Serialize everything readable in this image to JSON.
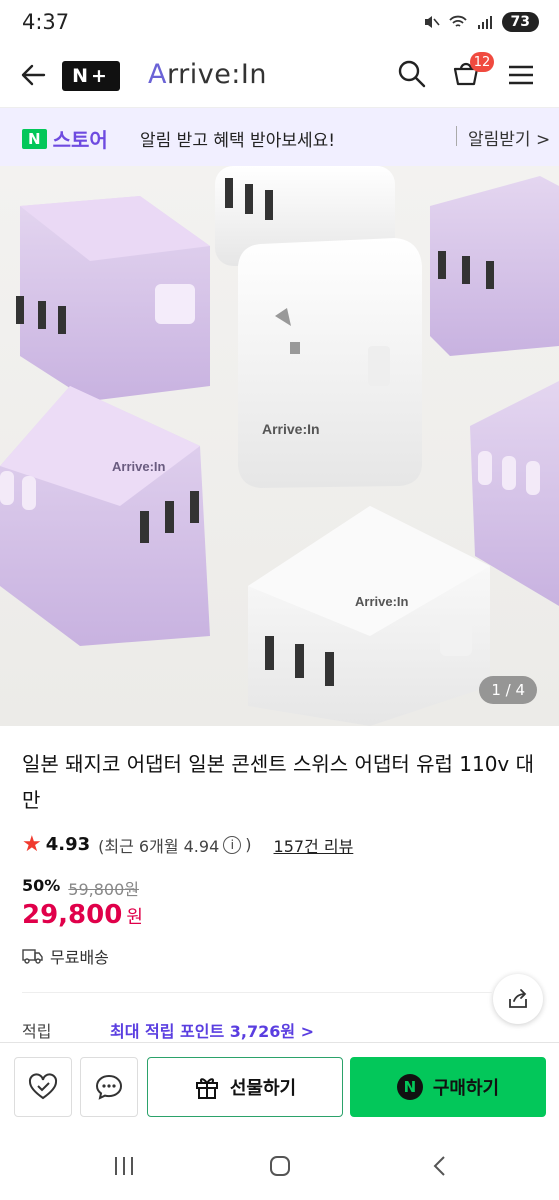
{
  "status": {
    "time": "4:37",
    "battery": "73"
  },
  "header": {
    "store_logo": "N+",
    "brand_initial": "A",
    "brand_rest": "rrive:In",
    "cart_count": "12"
  },
  "promo": {
    "badge": "N",
    "store": "스토어",
    "message": "알림 받고 혜택 받아보세요!",
    "action": "알림받기 >"
  },
  "hero": {
    "counter": "1 / 4"
  },
  "product": {
    "title": "일본 돼지코 어댑터 일본 콘센트 스위스 어댑터 유럽 110v 대만",
    "rating": "4.93",
    "recent_rating": "(최근 6개월 4.94",
    "recent_close": ")",
    "info": "i",
    "reviews": "157건 리뷰",
    "discount": "50%",
    "original_price": "59,800원",
    "price": "29,800",
    "currency": "원",
    "shipping": "무료배송",
    "points_label": "적립",
    "points_value": "최대 적립 포인트 3,726원 >"
  },
  "actions": {
    "gift": "선물하기",
    "buy": "구매하기",
    "buy_badge": "N"
  },
  "colors": {
    "accent": "#03c75a",
    "price": "#e0004a",
    "purple": "#6e4be0"
  },
  "icons": [
    "back-arrow-icon",
    "search-icon",
    "cart-icon",
    "menu-icon",
    "heart-check-icon",
    "chat-icon",
    "gift-icon",
    "share-icon",
    "truck-icon",
    "star-icon",
    "info-icon"
  ]
}
